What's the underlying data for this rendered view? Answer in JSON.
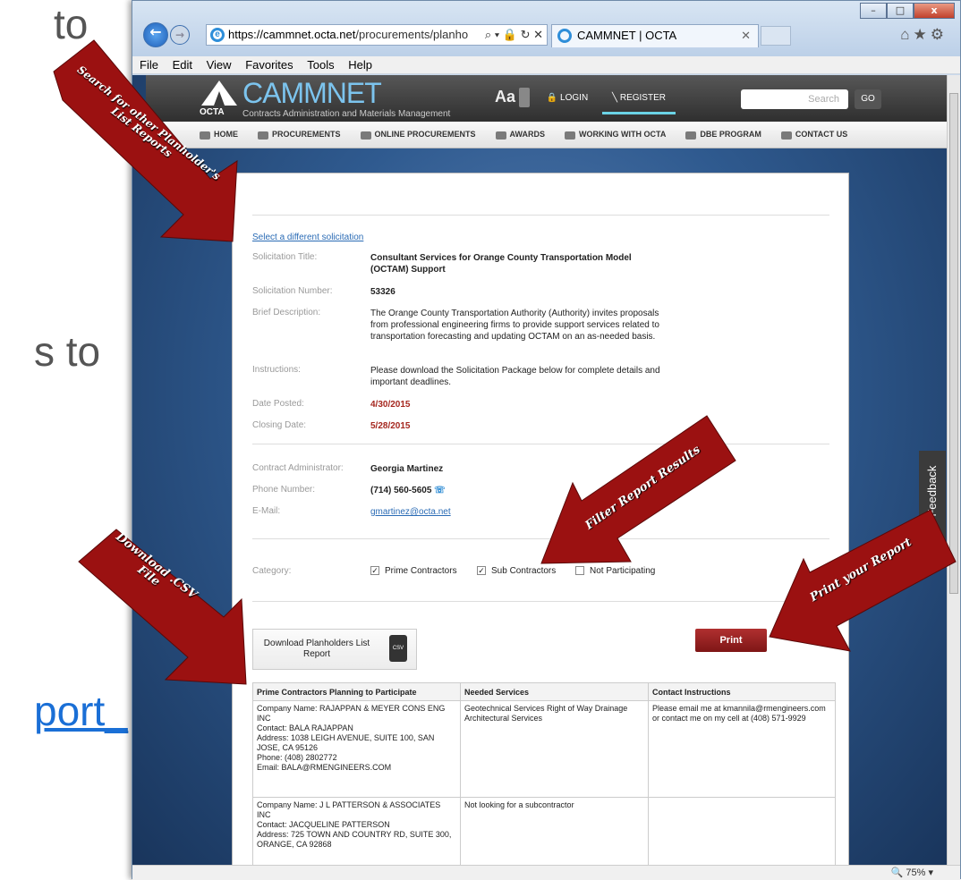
{
  "slide": {
    "bg_text_1": "to",
    "bg_text_2": "s to",
    "bg_text_3": "port_"
  },
  "browser": {
    "url_host": "https://cammnet.octa.net",
    "url_path": "/procurements/planho",
    "url_controls": "⌕ ▾ 🔒 ↻ ✕",
    "tab_title": "CAMMNET | OCTA",
    "tab_close": "✕",
    "menu": [
      "File",
      "Edit",
      "View",
      "Favorites",
      "Tools",
      "Help"
    ],
    "zoom": "🔍 75%  ▾",
    "win_min": "–",
    "win_max": "□",
    "win_close": "x",
    "toolbar_icons": "⌂★⚙"
  },
  "site": {
    "brand": "CAMMNET",
    "logo_text": "OCTA",
    "tagline": "Contracts Administration and Materials Management",
    "font_size_label": "Aa",
    "login": "LOGIN",
    "register": "REGISTER",
    "search_placeholder": "Search",
    "go": "GO",
    "nav": [
      "HOME",
      "PROCUREMENTS",
      "ONLINE PROCUREMENTS",
      "AWARDS",
      "WORKING WITH OCTA",
      "DBE PROGRAM",
      "CONTACT US"
    ],
    "feedback": "Give Feedback"
  },
  "solicitation": {
    "select_link": "Select a different solicitation",
    "title_label": "Solicitation Title:",
    "title": "Consultant Services for Orange County Transportation Model (OCTAM) Support",
    "number_label": "Solicitation Number:",
    "number": "53326",
    "desc_label": "Brief Description:",
    "desc": "The Orange County Transportation Authority (Authority) invites proposals from professional engineering firms to provide support services related to transportation forecasting and updating OCTAM on an as-needed basis.",
    "instr_label": "Instructions:",
    "instr": "Please download the Solicitation Package below for complete details and important deadlines.",
    "posted_label": "Date Posted:",
    "posted": "4/30/2015",
    "closing_label": "Closing Date:",
    "closing": "5/28/2015",
    "admin_label": "Contract Administrator:",
    "admin": "Georgia Martinez",
    "phone_label": "Phone Number:",
    "phone": "(714) 560-5605",
    "email_label": "E-Mail:",
    "email": "gmartinez@octa.net",
    "category_label": "Category:",
    "categories": [
      {
        "label": "Prime Contractors",
        "checked": "✓"
      },
      {
        "label": "Sub Contractors",
        "checked": "✓"
      },
      {
        "label": "Not Participating",
        "checked": ""
      }
    ],
    "download_label": "Download Planholders List Report",
    "csv": "CSV",
    "print": "Print"
  },
  "table": {
    "headers": [
      "Prime Contractors Planning to Participate",
      "Needed Services",
      "Contact Instructions"
    ],
    "rows": [
      {
        "company": "Company Name: RAJAPPAN & MEYER CONS ENG INC\nContact: BALA RAJAPPAN\nAddress: 1038 LEIGH AVENUE, SUITE 100, SAN JOSE, CA 95126\nPhone: (408) 2802772\nEmail: BALA@RMENGINEERS.COM",
        "services": "Geotechnical Services Right of Way Drainage Architectural Services",
        "contact": "Please email me at kmannila@rmengineers.com or contact me on my cell at (408) 571-9929"
      },
      {
        "company": "Company Name: J L PATTERSON & ASSOCIATES INC\nContact: JACQUELINE PATTERSON\nAddress: 725 TOWN AND COUNTRY RD, SUITE 300, ORANGE, CA 92868",
        "services": "Not looking for a subcontractor",
        "contact": ""
      }
    ]
  },
  "annotations": {
    "search": "Search for other Planholder's List Reports",
    "filter": "Filter Report Results",
    "download": "Download .CSV File",
    "print": "Print your Report",
    "color": "#9b1111"
  }
}
